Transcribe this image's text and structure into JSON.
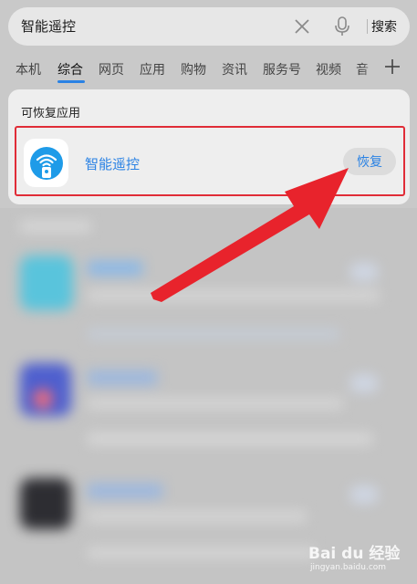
{
  "search": {
    "query": "智能遥控",
    "submit_label": "搜索"
  },
  "tabs": [
    {
      "label": "本机"
    },
    {
      "label": "综合"
    },
    {
      "label": "网页"
    },
    {
      "label": "应用"
    },
    {
      "label": "购物"
    },
    {
      "label": "资讯"
    },
    {
      "label": "服务号"
    },
    {
      "label": "视频"
    },
    {
      "label": "音"
    }
  ],
  "active_tab": "综合",
  "popup": {
    "title": "可恢复应用",
    "app_name": "智能遥控",
    "restore_label": "恢复",
    "app_icon": "remote-control-app-icon"
  },
  "colors": {
    "accent": "#2a82e4",
    "highlight": "#e02c37",
    "arrow": "#e8232c"
  },
  "watermark": {
    "brand": "Bai du 经验",
    "url": "jingyan.baidu.com"
  }
}
